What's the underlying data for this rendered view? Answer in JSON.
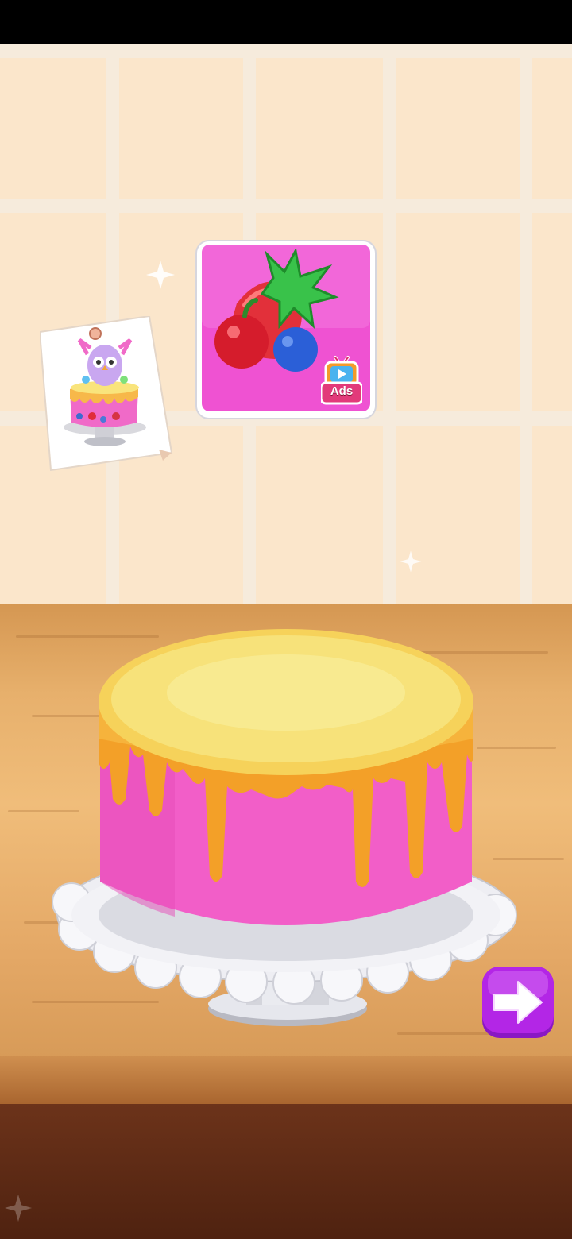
{
  "scene": {
    "wall_color": "#f6ebdc",
    "tile_color": "#fbe6cb",
    "counter_color": "#e7b06c",
    "floor_color": "#5a2a14"
  },
  "recipe_card": {
    "icon": "cake-reference-icon"
  },
  "fruit_topping": {
    "icon": "fruit-topping-icon",
    "fruits": [
      "strawberry",
      "cherry",
      "blueberry"
    ],
    "ads_label": "Ads",
    "box_color": "#f04fd0"
  },
  "cake": {
    "frosting_color": "#f25ec8",
    "drip_color": "#f3a028",
    "top_color": "#f6e070"
  },
  "next_button": {
    "icon": "arrow-right-icon",
    "color": "#b326e6"
  }
}
